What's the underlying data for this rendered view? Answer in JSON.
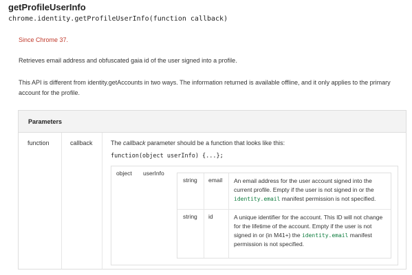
{
  "title": "getProfileUserInfo",
  "signature": "chrome.identity.getProfileUserInfo(function callback)",
  "since": "Since Chrome 37.",
  "description1": "Retrieves email address and obfuscated gaia id of the user signed into a profile.",
  "description2": "This API is different from identity.getAccounts in two ways. The information returned is available offline, and it only applies to the primary account for the profile.",
  "params": {
    "header": "Parameters",
    "name": "function",
    "type": "callback",
    "desc_prefix": "The ",
    "desc_em": "callback",
    "desc_suffix": " parameter should be a function that looks like this:",
    "code": "function(object userInfo) {...};",
    "object": {
      "type": "object",
      "name": "userInfo",
      "rows": [
        {
          "type": "string",
          "name": "email",
          "desc_a": "An email address for the user account signed into the current profile. Empty if the user is not signed in or the ",
          "code": "identity.email",
          "desc_b": " manifest permission is not specified."
        },
        {
          "type": "string",
          "name": "id",
          "desc_a": "A unique identifier for the account. This ID will not change for the lifetime of the account. Empty if the user is not signed in or (in M41+) the ",
          "code": "identity.email",
          "desc_b": " manifest permission is not specified."
        }
      ]
    }
  }
}
